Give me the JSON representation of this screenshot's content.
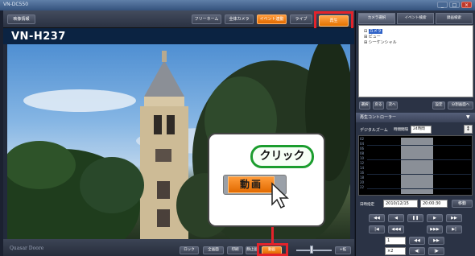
{
  "window": {
    "title": "VN-DC550",
    "min_label": "_",
    "max_label": "□",
    "close_label": "×"
  },
  "toolbar": {
    "left_label": "映像情報",
    "nav": [
      "フリーネーム",
      "全体カメラ",
      "イベント連動",
      "ライブ"
    ],
    "playback_label": "再生"
  },
  "camera": {
    "name": "VN-H237"
  },
  "callout": {
    "click_text": "クリック",
    "movie_label": "動画"
  },
  "bottom": {
    "brand": "Quasar Doore",
    "buttons": [
      "ロック",
      "全画面",
      "印刷",
      "静止画"
    ],
    "movie_label": "動画",
    "end_label": "+拡"
  },
  "right": {
    "tabs": [
      "カメラ選択",
      "イベント検索",
      "録画検索"
    ],
    "tree": [
      "カメラ",
      "ビュー",
      "シーケンシャル"
    ],
    "small_buttons": [
      "選択",
      "戻る",
      "次へ"
    ],
    "settings_buttons": [
      "設定",
      "分割画面へ"
    ],
    "playctl_title": "再生コントローラー",
    "playctl_arrow": "▼",
    "zoom_label": "デジタルズーム",
    "interval_label": "時間間隔",
    "interval_value": "24時間",
    "timeline_button": "↕",
    "timeline_ticks": [
      "02",
      "04",
      "06",
      "08",
      "10",
      "12",
      "14",
      "16",
      "18",
      "20",
      "22"
    ],
    "date_label": "日時指定",
    "date_value": "2010/12/15",
    "time_value": "20:00:30",
    "move_label": "移動",
    "row1": [
      "◀◀",
      "◀",
      "❚❚",
      "▶",
      "▶▶"
    ],
    "row2": [
      "|◀",
      "◀◀◀",
      "▶▶▶",
      "▶|"
    ],
    "speed_value": "1",
    "step_value": "×2",
    "row3": [
      "◀◀",
      "▶▶"
    ],
    "row4": [
      "◀|",
      "|▶"
    ]
  }
}
